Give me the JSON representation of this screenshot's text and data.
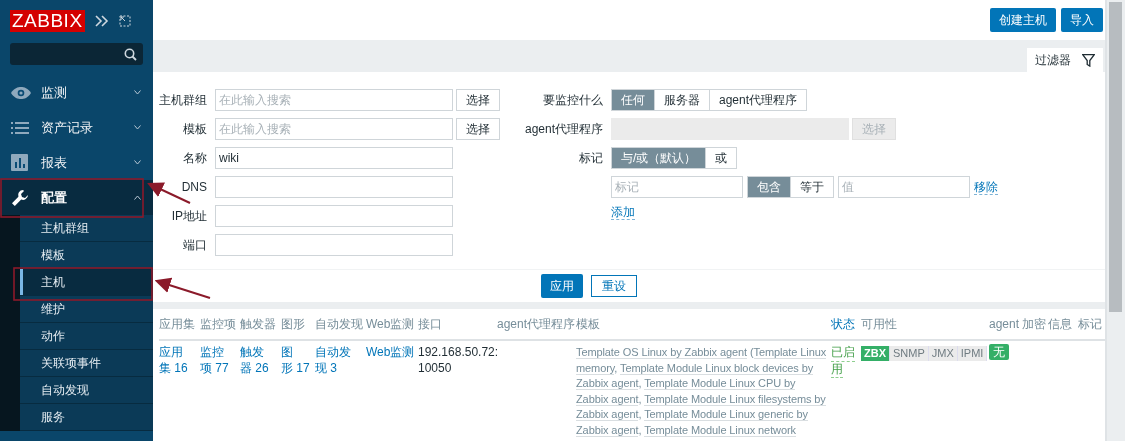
{
  "sidebar": {
    "logo": "ZABBIX",
    "menu": [
      {
        "label": "监测",
        "expanded": false
      },
      {
        "label": "资产记录",
        "expanded": false
      },
      {
        "label": "报表",
        "expanded": false
      },
      {
        "label": "配置",
        "expanded": true,
        "children": [
          {
            "label": "主机群组",
            "selected": false
          },
          {
            "label": "模板",
            "selected": false
          },
          {
            "label": "主机",
            "selected": true
          },
          {
            "label": "维护",
            "selected": false
          },
          {
            "label": "动作",
            "selected": false
          },
          {
            "label": "关联项事件",
            "selected": false
          },
          {
            "label": "自动发现",
            "selected": false
          },
          {
            "label": "服务",
            "selected": false
          }
        ]
      }
    ]
  },
  "header": {
    "buttons": [
      "创建主机",
      "导入"
    ]
  },
  "filter": {
    "tab": "过滤器",
    "left": [
      {
        "label": "主机群组",
        "placeholder": "在此输入搜索",
        "button": "选择"
      },
      {
        "label": "模板",
        "placeholder": "在此输入搜索",
        "button": "选择"
      },
      {
        "label": "名称",
        "value": "wiki"
      },
      {
        "label": "DNS"
      },
      {
        "label": "IP地址"
      },
      {
        "label": "端口"
      }
    ],
    "monitored_by": {
      "label": "要监控什么",
      "options": [
        {
          "label": "任何",
          "selected": true
        },
        {
          "label": "服务器",
          "selected": false
        },
        {
          "label": "agent代理程序",
          "selected": false
        }
      ]
    },
    "proxy": {
      "label": "agent代理程序",
      "button": "选择",
      "disabled": true
    },
    "tags": {
      "label": "标记",
      "options": [
        {
          "label": "与/或（默认）",
          "selected": true
        },
        {
          "label": "或",
          "selected": false
        }
      ],
      "row": {
        "tag_placeholder": "标记",
        "operators": [
          {
            "label": "包含",
            "selected": true
          },
          {
            "label": "等于",
            "selected": false
          }
        ],
        "value_placeholder": "值",
        "remove": "移除"
      },
      "add": "添加"
    },
    "apply": "应用",
    "reset": "重设"
  },
  "table": {
    "columns": [
      {
        "label": "应用集",
        "sortable": false
      },
      {
        "label": "监控项",
        "sortable": false
      },
      {
        "label": "触发器",
        "sortable": false
      },
      {
        "label": "图形",
        "sortable": false
      },
      {
        "label": "自动发现",
        "sortable": false
      },
      {
        "label": "Web监测",
        "sortable": false
      },
      {
        "label": "接口",
        "sortable": false
      },
      {
        "label": "agent代理程序",
        "sortable": false
      },
      {
        "label": "模板",
        "sortable": false
      },
      {
        "label": "状态",
        "sortable": true
      },
      {
        "label": "可用性",
        "sortable": false
      },
      {
        "label": "agent 加密",
        "sortable": false
      },
      {
        "label": "信息",
        "sortable": false
      },
      {
        "label": "标记",
        "sortable": false
      }
    ],
    "rows": [
      {
        "applications": [
          "应用",
          "集 16"
        ],
        "items": [
          "监控",
          "项 77"
        ],
        "triggers": [
          "触发",
          "器 26"
        ],
        "graphs": [
          "图",
          "形 17"
        ],
        "discovery": [
          "自动发",
          "现 3"
        ],
        "web": "Web监测",
        "interface": [
          "192.168.50.72:",
          "10050"
        ],
        "templates": [
          [
            {
              "kind": "link",
              "text": "Template OS Linux by Zabbix agent"
            },
            {
              "kind": "plain",
              "text": " ("
            },
            {
              "kind": "link",
              "text": "Template Linux"
            }
          ],
          [
            {
              "kind": "link",
              "text": "memory"
            },
            {
              "kind": "plain",
              "text": ", "
            },
            {
              "kind": "link",
              "text": "Template Module Linux block devices by"
            }
          ],
          [
            {
              "kind": "link",
              "text": "Zabbix agent"
            },
            {
              "kind": "plain",
              "text": ", "
            },
            {
              "kind": "link",
              "text": "Template Module Linux CPU by"
            }
          ],
          [
            {
              "kind": "link",
              "text": "Zabbix agent"
            },
            {
              "kind": "plain",
              "text": ", "
            },
            {
              "kind": "link",
              "text": "Template Module Linux filesystems by"
            }
          ],
          [
            {
              "kind": "link",
              "text": "Zabbix agent"
            },
            {
              "kind": "plain",
              "text": ", "
            },
            {
              "kind": "link",
              "text": "Template Module Linux generic by"
            }
          ],
          [
            {
              "kind": "link",
              "text": "Zabbix agent"
            },
            {
              "kind": "plain",
              "text": ", "
            },
            {
              "kind": "link",
              "text": "Template Module Linux network"
            }
          ]
        ],
        "status": {
          "lines": [
            "已启",
            "用"
          ],
          "enabled": true
        },
        "availability": [
          {
            "label": "ZBX",
            "on": true
          },
          {
            "label": "SNMP",
            "on": false
          },
          {
            "label": "JMX",
            "on": false
          },
          {
            "label": "IPMI",
            "on": false
          }
        ],
        "encryption": "无"
      }
    ]
  }
}
